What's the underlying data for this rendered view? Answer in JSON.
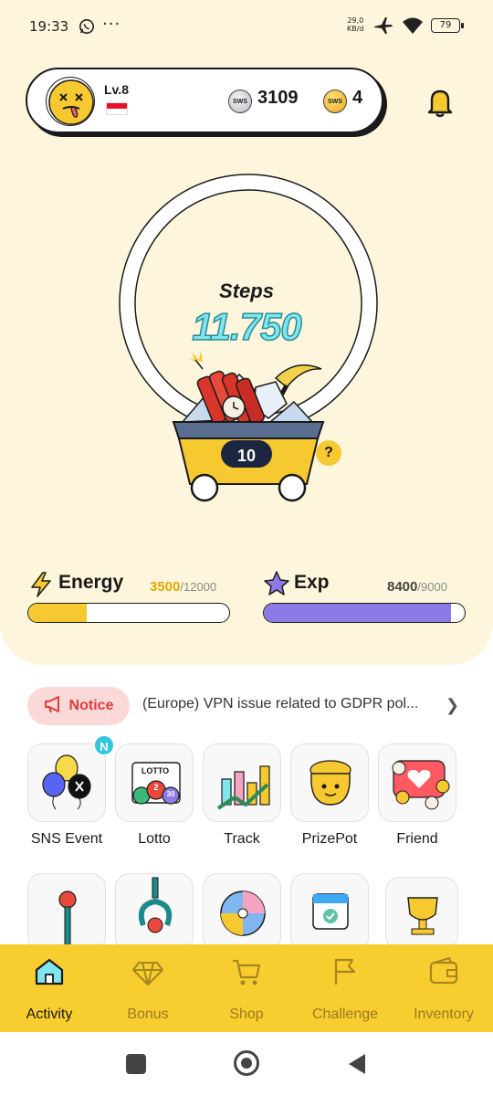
{
  "status_bar": {
    "time": "19:33",
    "dots": "···",
    "net_speed": "29,0",
    "net_unit": "KB/d",
    "battery": "79"
  },
  "profile": {
    "level": "Lv.8",
    "silver_coins": "3109",
    "gold_coins": "4",
    "coin_text": "SWS"
  },
  "steps": {
    "label": "Steps",
    "value": "11.750",
    "mining_count": "10",
    "help": "?"
  },
  "energy": {
    "label": "Energy",
    "value": "3500",
    "max": "/12000",
    "fraction": 0.2917
  },
  "exp": {
    "label": "Exp",
    "value": "8400",
    "max": "/9000",
    "fraction": 0.9333
  },
  "notice": {
    "label": "Notice",
    "text": "(Europe) VPN issue related to GDPR pol..."
  },
  "features_row1": [
    {
      "label": "SNS Event",
      "badge": "N"
    },
    {
      "label": "Lotto",
      "lotto_sign": "LOTTO",
      "ball_numbers": [
        "2",
        "30"
      ]
    },
    {
      "label": "Track"
    },
    {
      "label": "PrizePot"
    },
    {
      "label": "Friend"
    }
  ],
  "tabs": [
    {
      "label": "Activity",
      "icon": "home-icon",
      "active": true
    },
    {
      "label": "Bonus",
      "icon": "diamond-icon"
    },
    {
      "label": "Shop",
      "icon": "cart-icon"
    },
    {
      "label": "Challenge",
      "icon": "flag-icon"
    },
    {
      "label": "Inventory",
      "icon": "wallet-icon"
    }
  ],
  "colors": {
    "accent": "#f8cd30",
    "background": "#fdf6dc",
    "steps_text": "#7fe6f0",
    "notice": "#e23b3b",
    "exp_star": "#8c7ae6"
  }
}
